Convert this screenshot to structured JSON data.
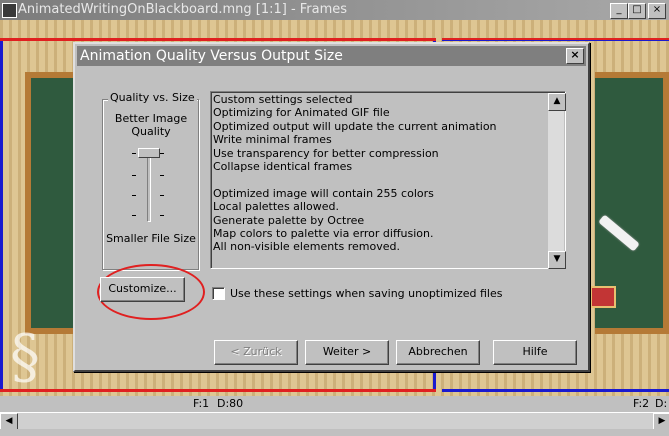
{
  "window": {
    "title": "AnimatedWritingOnBlackboard.mng [1:1] - Frames",
    "minimize_glyph": "_",
    "maximize_glyph": "□",
    "close_glyph": "×"
  },
  "dialog": {
    "title": "Animation Quality Versus Output Size",
    "close_glyph": "×",
    "group_label": "Quality vs. Size",
    "better_label": "Better Image Quality",
    "smaller_label": "Smaller File Size",
    "info_lines": [
      "Custom settings selected",
      "Optimizing for Animated GIF file",
      "Optimized output will update the current animation",
      "Write minimal frames",
      "Use transparency for better compression",
      "Collapse identical frames",
      "",
      "Optimized image will contain 255 colors",
      "Local palettes allowed.",
      "Generate palette by Octree",
      "Map colors to palette via error diffusion.",
      "All non-visible elements removed."
    ],
    "customize_label": "Customize...",
    "checkbox_label": "Use these settings when saving unoptimized files",
    "checkbox_checked": false,
    "back_label": "< Zurück",
    "next_label": "Weiter >",
    "cancel_label": "Abbrechen",
    "help_label": "Hilfe",
    "slider_level": 1.0
  },
  "status": {
    "left_frame": "F:1",
    "left_delay": "D:80",
    "right_frame": "F:2",
    "right_delay": "D:"
  },
  "colors": {
    "frame_selected": "#1a1acf",
    "highlight": "#e02020",
    "title_inactive": "#7f7f7f"
  }
}
